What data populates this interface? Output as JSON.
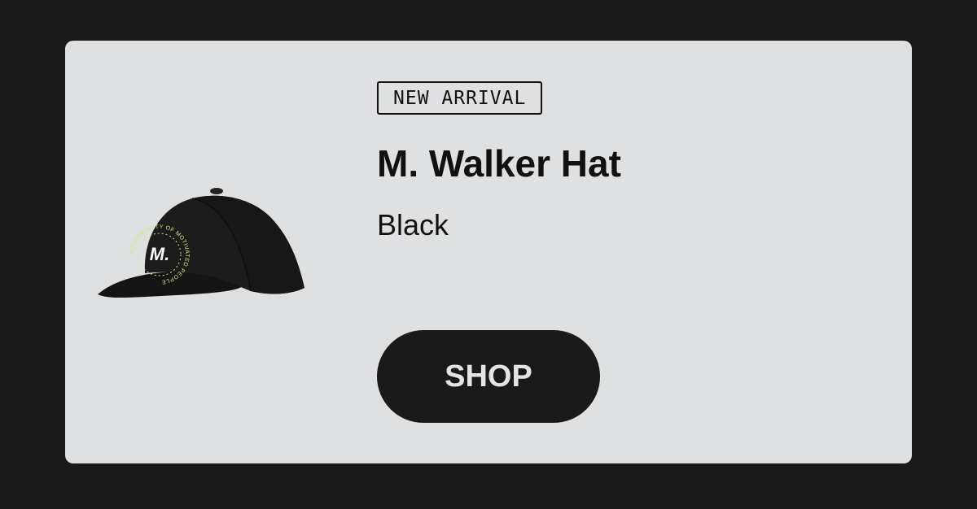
{
  "product": {
    "badge": "NEW ARRIVAL",
    "name": "M. Walker Hat",
    "color": "Black",
    "image": {
      "icon": "cap-icon",
      "logo_text": "M.",
      "ring_text": "A COMMUNITY OF MOTIVATED PEOPLE",
      "accent_color": "#c6f06b"
    }
  },
  "cta": {
    "label": "SHOP"
  },
  "colors": {
    "page_background": "#1a1a1a",
    "card_background": "#dfe0e1",
    "button_background": "#1a1a1a",
    "button_text": "#e4e4e4"
  }
}
